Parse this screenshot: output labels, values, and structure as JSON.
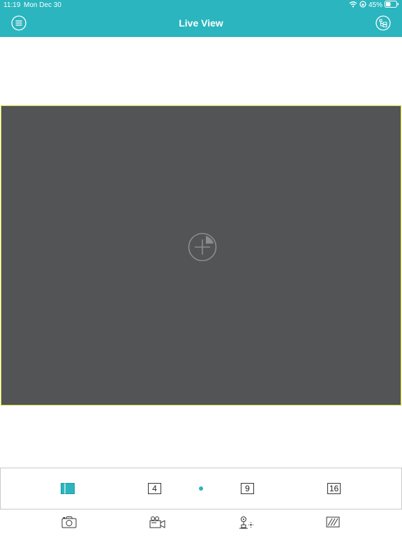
{
  "status_bar": {
    "time": "11:19",
    "date": "Mon Dec 30",
    "battery": "45%"
  },
  "header": {
    "title": "Live View",
    "left_icon": "menu-icon",
    "right_icon": "device-tree-icon"
  },
  "live_view": {
    "center_icon": "add-camera-icon"
  },
  "layout_bar": {
    "options": [
      {
        "label": "1",
        "icon": "single-window-icon",
        "selected": true
      },
      {
        "label": "4",
        "icon": "four-window-icon",
        "selected": false
      },
      {
        "label": "9",
        "icon": "nine-window-icon",
        "selected": false
      },
      {
        "label": "16",
        "icon": "sixteen-window-icon",
        "selected": false
      }
    ]
  },
  "toolbar": {
    "items": [
      "camera-snapshot-icon",
      "record-video-icon",
      "ptz-control-icon",
      "image-adjust-icon"
    ]
  },
  "colors": {
    "accent": "#2bb5be",
    "live_bg": "#535455",
    "live_border": "#d2d53b"
  }
}
